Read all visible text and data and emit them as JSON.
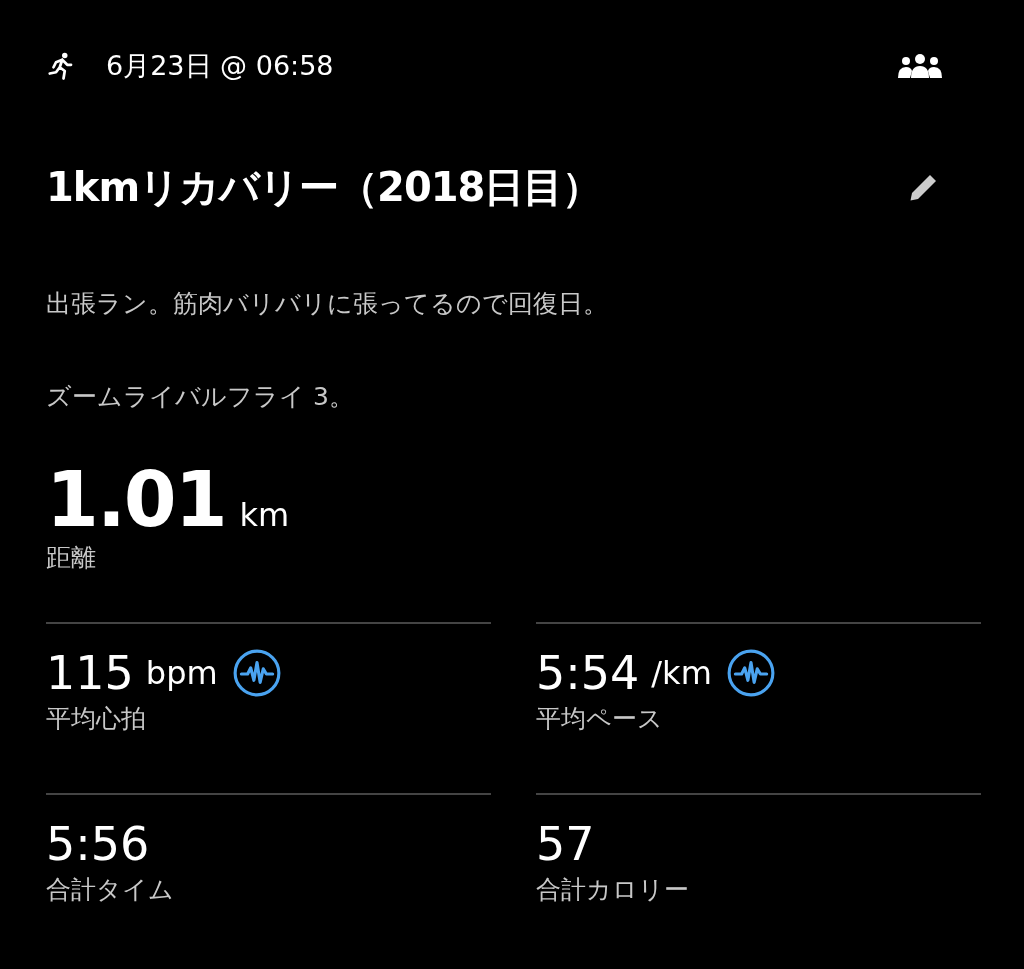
{
  "header": {
    "date": "6月23日 @ 06:58"
  },
  "title": "1kmリカバリー（2018日目）",
  "description": [
    "出張ラン。筋肉バリバリに張ってるので回復日。",
    "ズームライバルフライ 3。"
  ],
  "distance": {
    "value": "1.01",
    "unit": "km",
    "label": "距離"
  },
  "stats": [
    {
      "value": "115",
      "unit": "bpm",
      "label": "平均心拍",
      "pulse_icon": true
    },
    {
      "value": "5:54",
      "unit": "/km",
      "label": "平均ペース",
      "pulse_icon": true
    },
    {
      "value": "5:56",
      "label": "合計タイム",
      "pulse_icon": false
    },
    {
      "value": "57",
      "label": "合計カロリー",
      "pulse_icon": false
    }
  ]
}
